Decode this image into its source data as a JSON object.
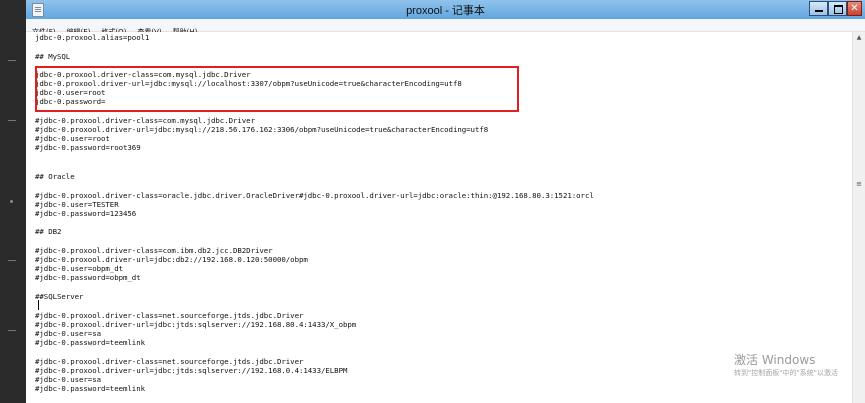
{
  "window": {
    "title": "proxool - 记事本",
    "controls": [
      "minimize",
      "maximize",
      "close"
    ]
  },
  "menubar": {
    "items": [
      "文件(F)",
      "编辑(E)",
      "格式(O)",
      "查看(V)",
      "帮助(H)"
    ]
  },
  "editor": {
    "lines": [
      "jdbc-0.proxool.alias=pool1",
      "",
      "## MySQL",
      "",
      "jdbc-0.proxool.driver-class=com.mysql.jdbc.Driver",
      "jdbc-0.proxool.driver-url=jdbc:mysql://localhost:3307/obpm?useUnicode=true&characterEncoding=utf8",
      "jdbc-0.user=root",
      "jdbc-0.password=",
      "",
      "#jdbc-0.proxool.driver-class=com.mysql.jdbc.Driver",
      "#jdbc-0.proxool.driver-url=jdbc:mysql://218.56.176.162:3306/obpm?useUnicode=true&characterEncoding=utf8",
      "#jdbc-0.user=root",
      "#jdbc-0.password=root369",
      "",
      "",
      "## Oracle",
      "",
      "#jdbc-0.proxool.driver-class=oracle.jdbc.driver.OracleDriver#jdbc-0.proxool.driver-url=jdbc:oracle:thin:@192.168.80.3:1521:orcl",
      "#jdbc-0.user=TESTER",
      "#jdbc-0.password=123456",
      "",
      "## DB2",
      "",
      "#jdbc-0.proxool.driver-class=com.ibm.db2.jcc.DB2Driver",
      "#jdbc-0.proxool.driver-url=jdbc:db2://192.168.0.120:50000/obpm",
      "#jdbc-0.user=obpm_dt",
      "#jdbc-0.password=obpm_dt",
      "",
      "##SQLServer",
      "",
      "#jdbc-0.proxool.driver-class=net.sourceforge.jtds.jdbc.Driver",
      "#jdbc-0.proxool.driver-url=jdbc:jtds:sqlserver://192.168.80.4:1433/X_obpm",
      "#jdbc-0.user=sa",
      "#jdbc-0.password=teemlink",
      "",
      "#jdbc-0.proxool.driver-class=net.sourceforge.jtds.jdbc.Driver",
      "#jdbc-0.proxool.driver-url=jdbc:jtds:sqlserver://192.168.0.4:1433/ELBPM",
      "#jdbc-0.user=sa",
      "#jdbc-0.password=teemlink"
    ]
  },
  "watermark": {
    "title": "激活 Windows",
    "subtitle": "转到\"控制面板\"中的\"系统\"以激活"
  },
  "colors": {
    "highlight_border": "#e02020",
    "titlebar": "#63a6de"
  }
}
